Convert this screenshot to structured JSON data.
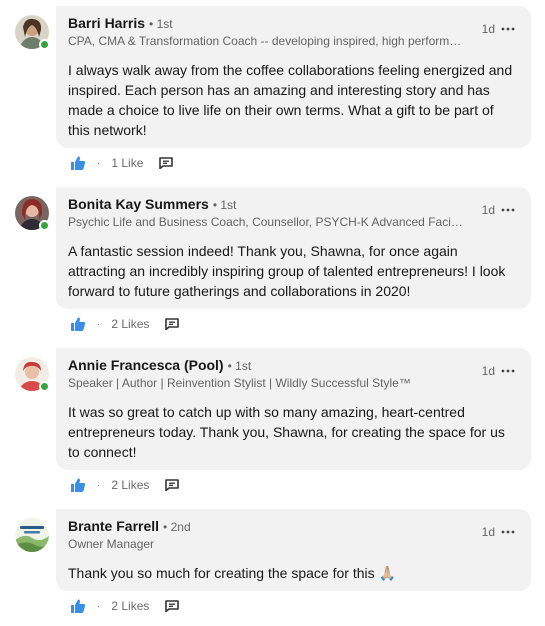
{
  "comments": [
    {
      "name": "Barri Harris",
      "degree": "1st",
      "headline": "CPA, CMA & Transformation Coach -- developing inspired, high performance teams",
      "time": "1d",
      "text": "I always walk away from the coffee collaborations feeling energized and inspired. Each person has an amazing and interesting story and has made a choice to live life on their own terms. What a gift to be part of this network!",
      "likes": "1 Like",
      "online": true
    },
    {
      "name": "Bonita Kay Summers",
      "degree": "1st",
      "headline": "Psychic Life and Business Coach, Counsellor, PSYCH-K Advanced Facilitator",
      "time": "1d",
      "text": "A fantastic session indeed! Thank you, Shawna, for once again attracting an incredibly inspiring group of talented entrepreneurs! I look forward to future gatherings and collaborations in 2020!",
      "likes": "2 Likes",
      "online": true
    },
    {
      "name": "Annie Francesca (Pool)",
      "degree": "1st",
      "headline": "Speaker | Author | Reinvention Stylist | Wildly Successful Style™",
      "time": "1d",
      "text": "It was so great to catch up with so many amazing, heart-centred entrepreneurs today. Thank you, Shawna, for creating the space for us to connect!",
      "likes": "2 Likes",
      "online": true
    },
    {
      "name": "Brante Farrell",
      "degree": "2nd",
      "headline": "Owner Manager",
      "time": "1d",
      "text": "Thank you so much for creating the space for this 🙏🏼",
      "likes": "2 Likes",
      "online": false
    }
  ],
  "icons": {
    "like": "thumbs-up-icon",
    "reply": "comment-icon",
    "more": "more-icon",
    "presence": "online-status-icon"
  },
  "colors": {
    "bubble": "#f2f2f2",
    "like_blue": "#378fe9",
    "online_green": "#37a33c"
  }
}
